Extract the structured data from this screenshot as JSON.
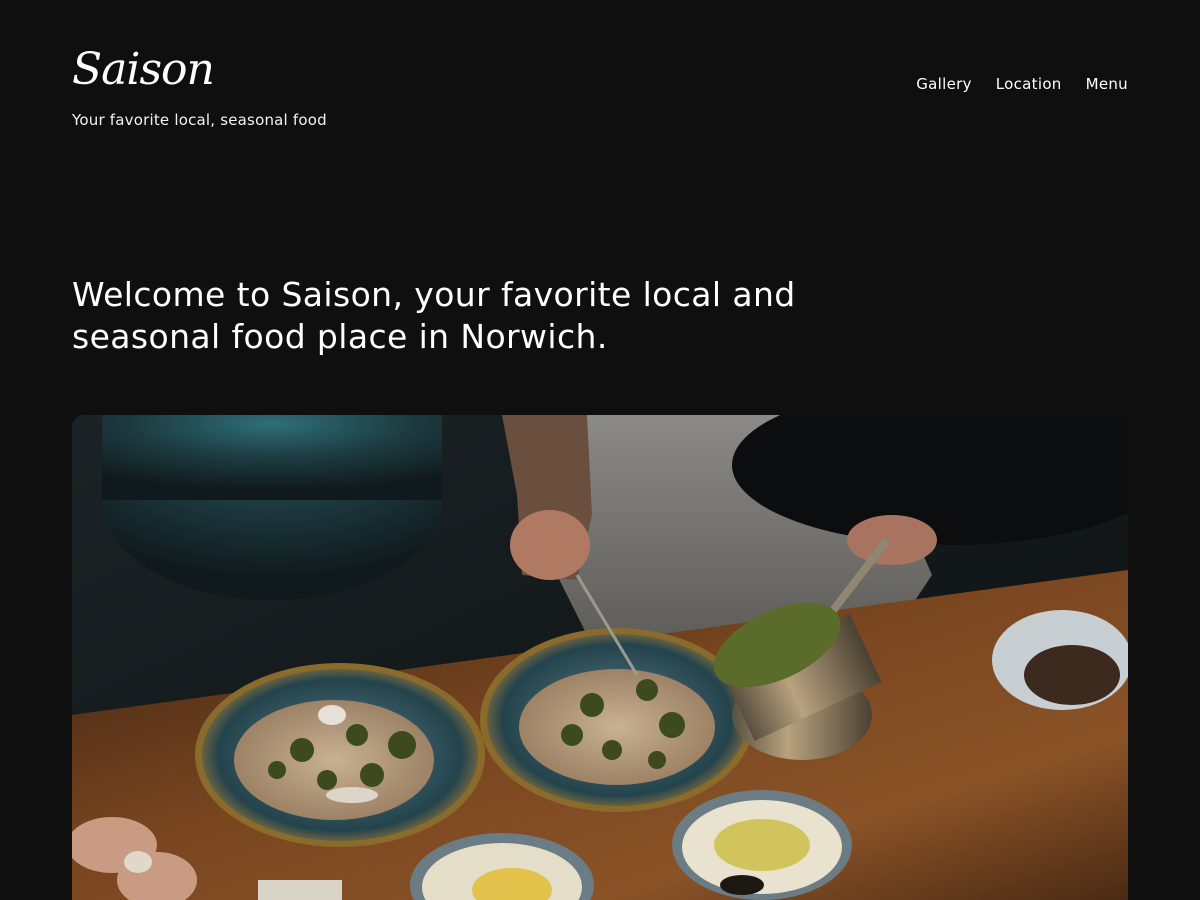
{
  "header": {
    "logo": "Saison",
    "tagline": "Your favorite local, seasonal food"
  },
  "nav": {
    "items": [
      "Gallery",
      "Location",
      "Menu"
    ]
  },
  "main": {
    "headline": "Welcome to Saison, your favorite local and seasonal food place in Norwich."
  },
  "colors": {
    "background": "#0f0f0f",
    "text": "#ffffff",
    "table_wood": "#6b3d1c"
  },
  "hero": {
    "image": "chef-plating-risotto-photo"
  }
}
